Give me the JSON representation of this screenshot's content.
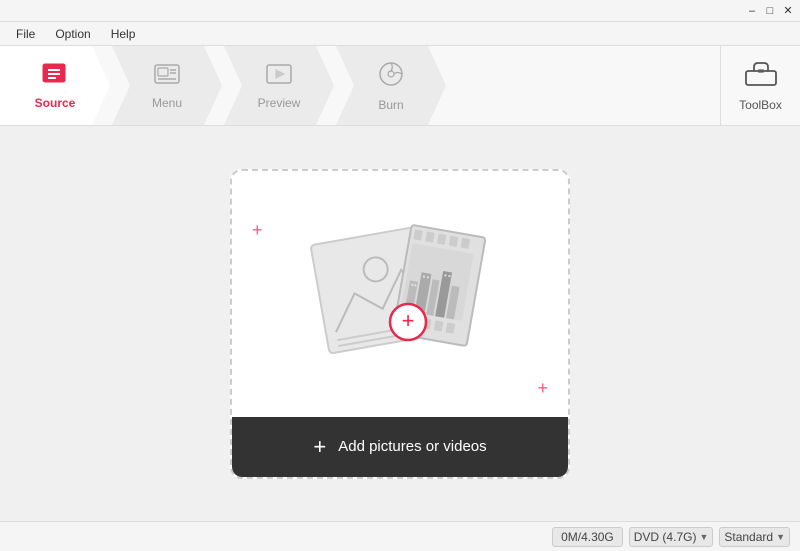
{
  "titlebar": {
    "minimize": "–",
    "maximize": "□",
    "close": "✕"
  },
  "menubar": {
    "items": [
      "File",
      "Option",
      "Help"
    ]
  },
  "nav": {
    "steps": [
      {
        "id": "source",
        "label": "Source",
        "active": true
      },
      {
        "id": "menu",
        "label": "Menu",
        "active": false
      },
      {
        "id": "preview",
        "label": "Preview",
        "active": false
      },
      {
        "id": "burn",
        "label": "Burn",
        "active": false
      }
    ],
    "toolbox_label": "ToolBox"
  },
  "dropzone": {
    "decoration_plus_tl": "+",
    "decoration_plus_br": "+",
    "add_plus": "+",
    "add_label": "Add pictures or videos"
  },
  "statusbar": {
    "storage": "0M/4.30G",
    "disc_type": "DVD (4.7G)",
    "quality": "Standard"
  }
}
